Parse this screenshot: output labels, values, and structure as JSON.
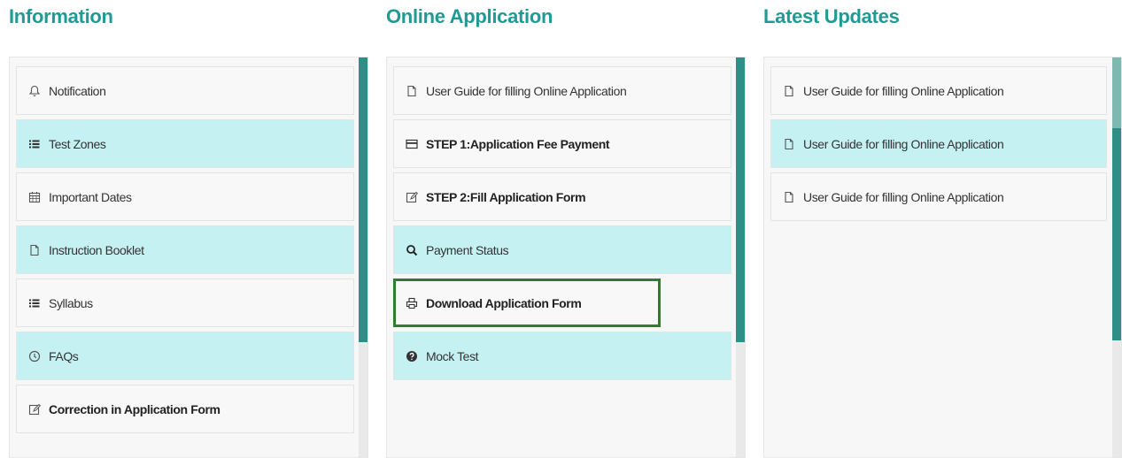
{
  "columns": [
    {
      "title": "Information",
      "items": [
        {
          "label": "Notification",
          "icon": "bell-icon",
          "style": "white",
          "bold": false
        },
        {
          "label": "Test Zones",
          "icon": "list-icon",
          "style": "cyan",
          "bold": false
        },
        {
          "label": "Important Dates",
          "icon": "calendar-icon",
          "style": "white",
          "bold": false
        },
        {
          "label": "Instruction Booklet",
          "icon": "file-icon",
          "style": "cyan",
          "bold": false
        },
        {
          "label": "Syllabus",
          "icon": "list-icon",
          "style": "white",
          "bold": false
        },
        {
          "label": "FAQs",
          "icon": "clock-icon",
          "style": "cyan",
          "bold": false
        },
        {
          "label": "Correction in Application Form",
          "icon": "edit-icon",
          "style": "white",
          "bold": true
        }
      ]
    },
    {
      "title": "Online Application",
      "items": [
        {
          "label": "User Guide for filling Online Application",
          "icon": "file-icon",
          "style": "white",
          "bold": false
        },
        {
          "label": "STEP 1:Application Fee Payment",
          "icon": "credit-card-icon",
          "style": "white",
          "bold": true
        },
        {
          "label": "STEP 2:Fill Application Form",
          "icon": "edit-icon",
          "style": "white",
          "bold": true
        },
        {
          "label": "Payment Status",
          "icon": "search-icon",
          "style": "cyan",
          "bold": true
        },
        {
          "label": "Download Application Form",
          "icon": "print-icon",
          "style": "white",
          "bold": true,
          "highlighted": true
        },
        {
          "label": "Mock Test",
          "icon": "question-circle-icon",
          "style": "cyan",
          "bold": false
        }
      ]
    },
    {
      "title": "Latest Updates",
      "items": [
        {
          "label": "User Guide for filling Online Application",
          "icon": "file-icon",
          "style": "white",
          "bold": false
        },
        {
          "label": "User Guide for filling Online Application",
          "icon": "file-icon",
          "style": "cyan",
          "bold": false
        },
        {
          "label": "User Guide for filling Online Application",
          "icon": "file-icon",
          "style": "white",
          "bold": false
        }
      ]
    }
  ],
  "colors": {
    "title": "#1f9a95",
    "cyan_row": "#c6f1f3",
    "white_row": "#f8f8f8",
    "scroll_thumb": "#2e8f86",
    "highlight_border": "#2e7d32"
  }
}
